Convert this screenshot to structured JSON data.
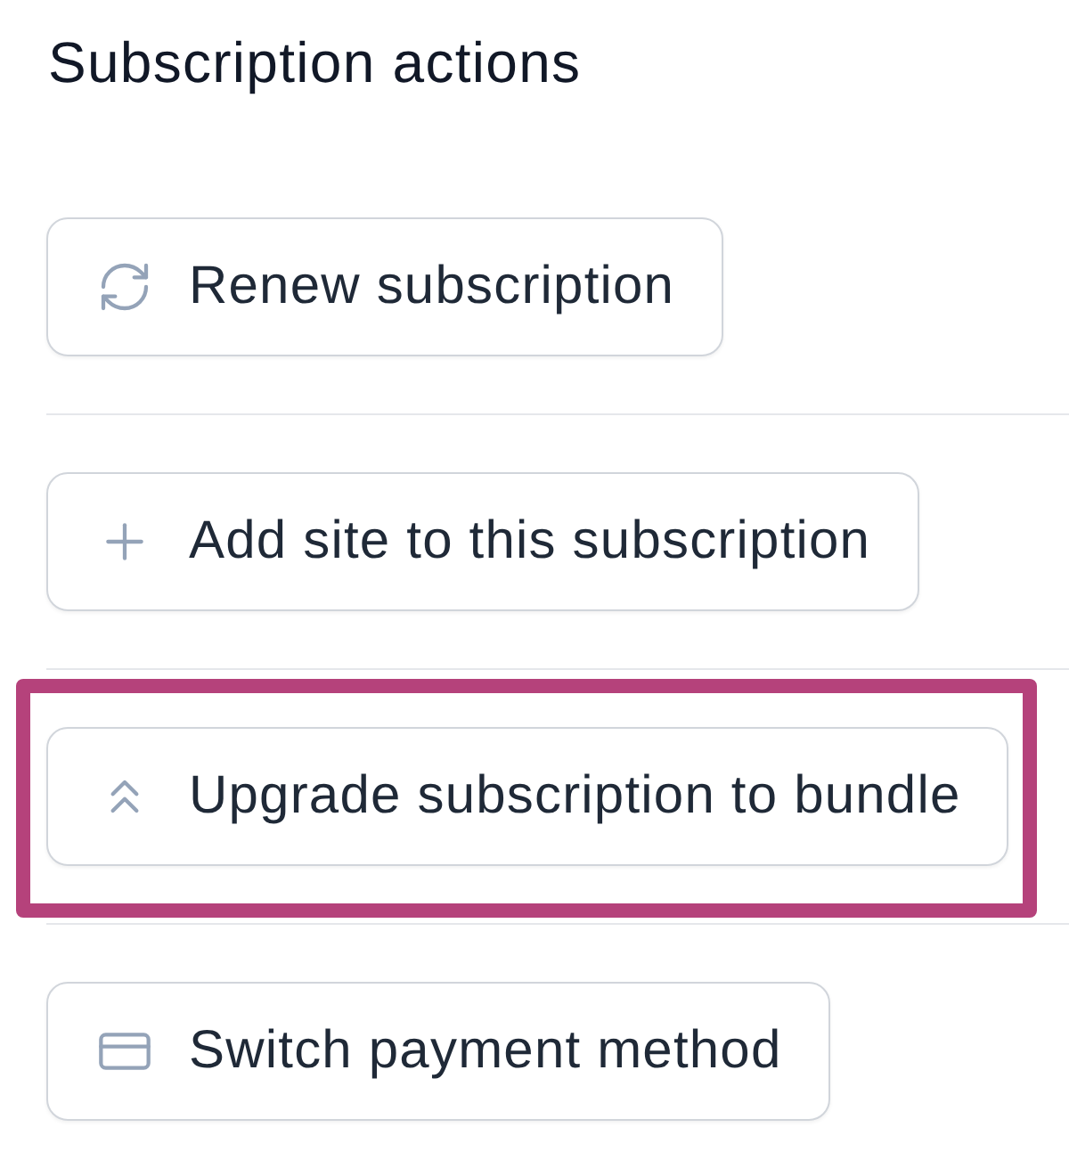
{
  "heading": "Subscription actions",
  "actions": [
    {
      "label": "Renew subscription",
      "highlighted": false
    },
    {
      "label": "Add site to this subscription",
      "highlighted": false
    },
    {
      "label": "Upgrade subscription to bundle",
      "highlighted": true
    },
    {
      "label": "Switch payment method",
      "highlighted": false
    }
  ]
}
